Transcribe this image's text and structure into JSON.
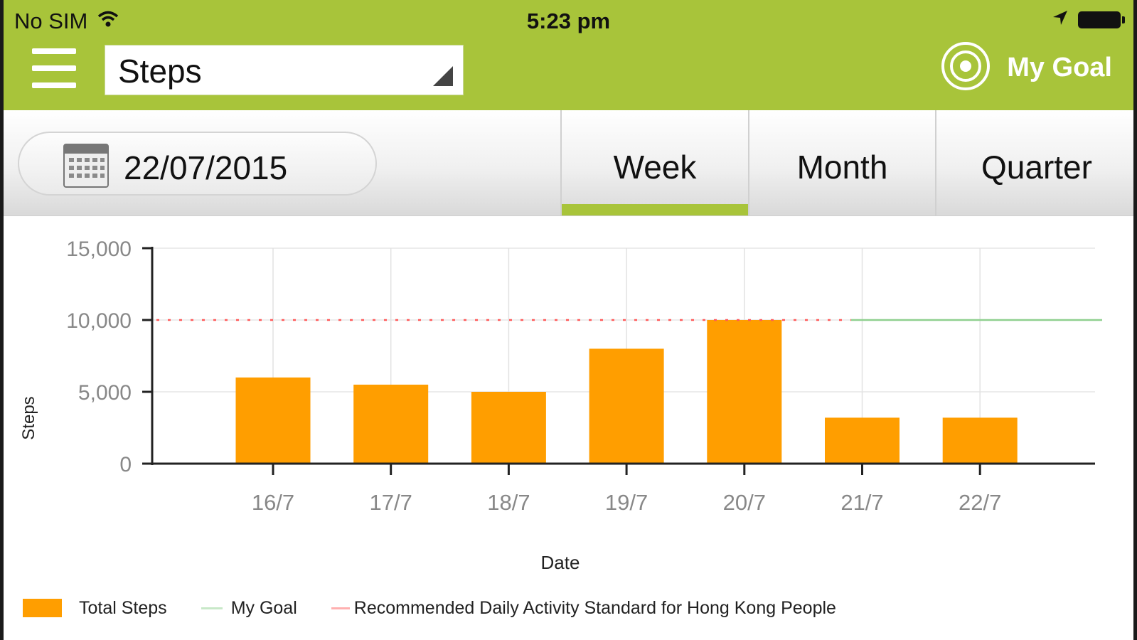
{
  "status_bar": {
    "carrier": "No SIM",
    "time": "5:23 pm"
  },
  "header": {
    "metric_select": "Steps",
    "goal_button_label": "My Goal"
  },
  "toolbar": {
    "date": "22/07/2015",
    "tabs": [
      {
        "label": "Week",
        "active": true
      },
      {
        "label": "Month",
        "active": false
      },
      {
        "label": "Quarter",
        "active": false
      }
    ]
  },
  "colors": {
    "brand_green": "#a8c43a",
    "bar": "#ff9e00",
    "goal_line": "#8fd08f",
    "standard_line": "#ff5a5a"
  },
  "chart_data": {
    "type": "bar",
    "xlabel": "Date",
    "ylabel": "Steps",
    "categories": [
      "16/7",
      "17/7",
      "18/7",
      "19/7",
      "20/7",
      "21/7",
      "22/7"
    ],
    "yticks": [
      "15,000",
      "10,000",
      "5,000",
      "0"
    ],
    "ylim": [
      0,
      15000
    ],
    "series": [
      {
        "name": "Total Steps",
        "values": [
          6000,
          5500,
          5000,
          8000,
          10000,
          3200,
          3200
        ]
      }
    ],
    "reference_lines": [
      {
        "name": "My Goal",
        "value": 10000,
        "style": "solid"
      },
      {
        "name": "Recommended Daily Activity Standard for Hong Kong People",
        "value": 10000,
        "style": "dotted"
      }
    ],
    "grid": true,
    "legend": {
      "placement": "bottom",
      "entries": [
        "Total Steps",
        "My Goal",
        "Recommended Daily Activity Standard for Hong Kong People"
      ]
    }
  }
}
